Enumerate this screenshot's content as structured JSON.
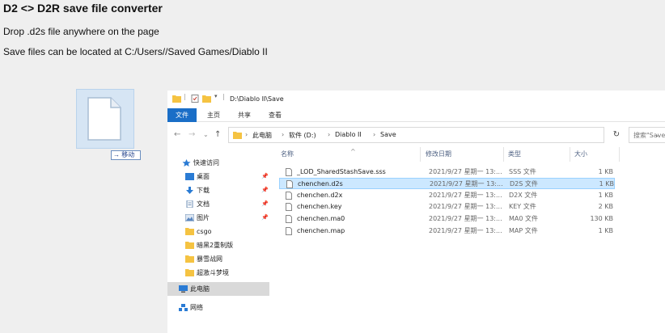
{
  "page": {
    "title": "D2 <> D2R save file converter",
    "drop_text": "Drop .d2s file anywhere on the page",
    "location_text": "Save files can be located at C:/Users//Saved Games/Diablo II"
  },
  "drag": {
    "move_label": "→ 移动"
  },
  "explorer": {
    "title_path": "D:\\Diablo II\\Save",
    "ribbon_tabs": [
      "文件",
      "主页",
      "共享",
      "查看"
    ],
    "breadcrumb": [
      "此电脑",
      "软件 (D:)",
      "Diablo II",
      "Save"
    ],
    "search_placeholder": "搜索\"Save\"",
    "nav_items": [
      {
        "label": "快速访问",
        "icon": "star-icon",
        "pinned": false
      },
      {
        "label": "桌面",
        "icon": "desktop-icon",
        "pinned": true
      },
      {
        "label": "下载",
        "icon": "download-icon",
        "pinned": true
      },
      {
        "label": "文档",
        "icon": "document-icon",
        "pinned": true
      },
      {
        "label": "图片",
        "icon": "picture-icon",
        "pinned": true
      },
      {
        "label": "csgo",
        "icon": "folder-icon",
        "pinned": false
      },
      {
        "label": "暗黑2重制版",
        "icon": "folder-icon",
        "pinned": false
      },
      {
        "label": "暴雪战网",
        "icon": "folder-icon",
        "pinned": false
      },
      {
        "label": "超激斗梦境",
        "icon": "folder-icon",
        "pinned": false
      },
      {
        "label": "此电脑",
        "icon": "computer-icon",
        "pinned": false
      },
      {
        "label": "网络",
        "icon": "network-icon",
        "pinned": false
      }
    ],
    "columns": [
      "名称",
      "修改日期",
      "类型",
      "大小"
    ],
    "files": [
      {
        "name": "_LOD_SharedStashSave.sss",
        "date": "2021/9/27 星期一 13:...",
        "type": "SSS 文件",
        "size": "1 KB",
        "selected": false
      },
      {
        "name": "chenchen.d2s",
        "date": "2021/9/27 星期一 13:...",
        "type": "D2S 文件",
        "size": "1 KB",
        "selected": true
      },
      {
        "name": "chenchen.d2x",
        "date": "2021/9/27 星期一 13:...",
        "type": "D2X 文件",
        "size": "1 KB",
        "selected": false
      },
      {
        "name": "chenchen.key",
        "date": "2021/9/27 星期一 13:...",
        "type": "KEY 文件",
        "size": "2 KB",
        "selected": false
      },
      {
        "name": "chenchen.ma0",
        "date": "2021/9/27 星期一 13:...",
        "type": "MA0 文件",
        "size": "130 KB",
        "selected": false
      },
      {
        "name": "chenchen.map",
        "date": "2021/9/27 星期一 13:...",
        "type": "MAP 文件",
        "size": "1 KB",
        "selected": false
      }
    ]
  },
  "colors": {
    "accent": "#1a6ec7",
    "selection": "#cce8ff",
    "folder": "#f5c342"
  }
}
